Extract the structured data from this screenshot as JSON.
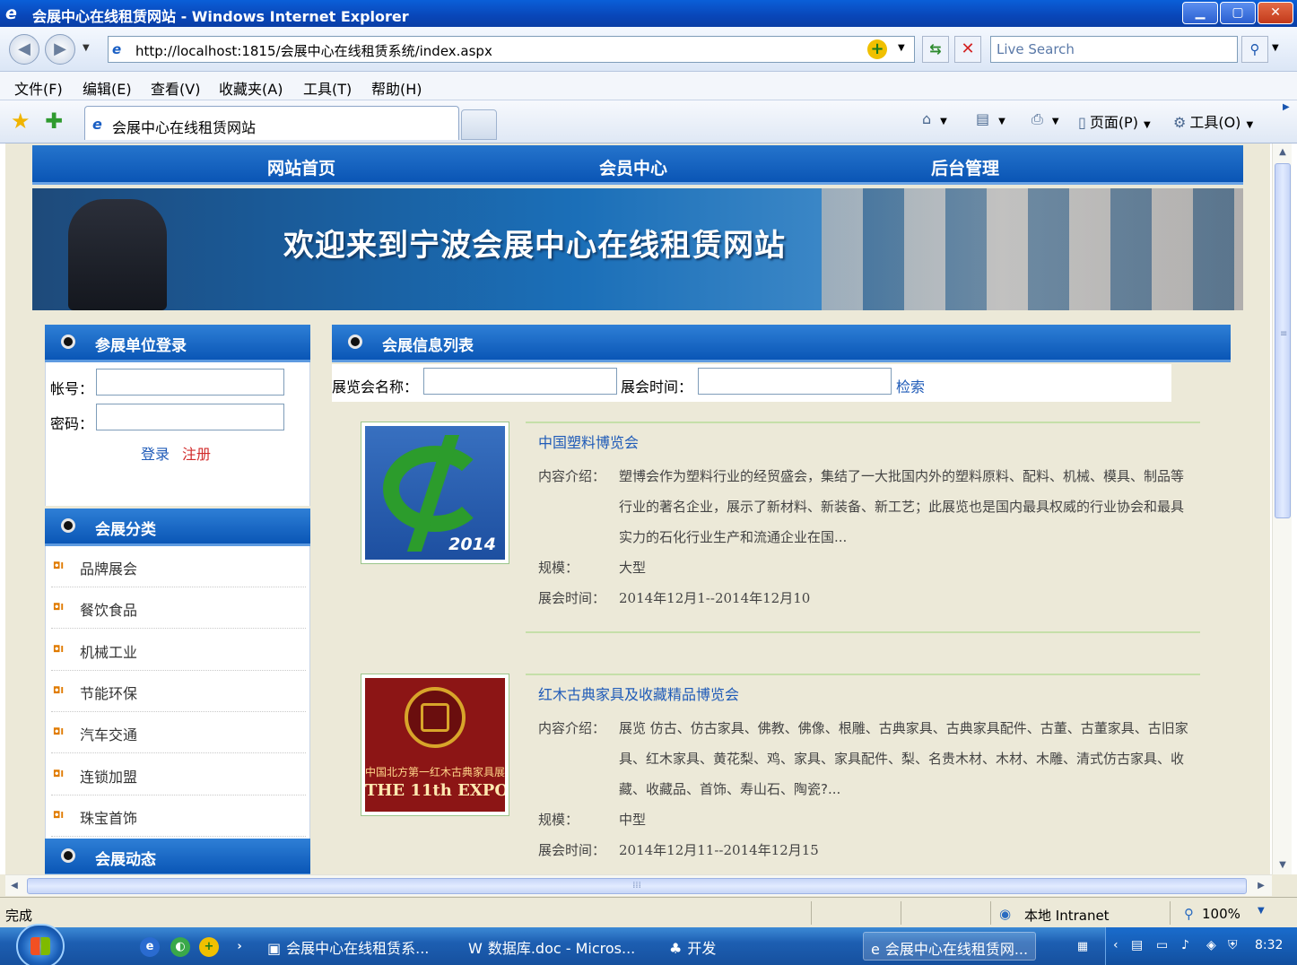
{
  "window": {
    "title": "会展中心在线租赁网站 - Windows Internet Explorer",
    "ie_glyph": "e",
    "buttons": {
      "minimize": "▁",
      "maximize": "▢",
      "close": "✕"
    }
  },
  "address": {
    "url": "http://localhost:1815/会展中心在线租赁系统/index.aspx",
    "search_placeholder": "Live Search"
  },
  "menu": [
    "文件(F)",
    "编辑(E)",
    "查看(V)",
    "收藏夹(A)",
    "工具(T)",
    "帮助(H)"
  ],
  "tab": {
    "title": "会展中心在线租赁网站"
  },
  "commands": {
    "page": "页面(P)",
    "tools": "工具(O)"
  },
  "site": {
    "nav": [
      "网站首页",
      "会员中心",
      "后台管理"
    ],
    "banner_text": "欢迎来到宁波会展中心在线租赁网站"
  },
  "login": {
    "heading": "参展单位登录",
    "account_label": "帐号：",
    "password_label": "密码：",
    "login_link": "登录",
    "register_link": "注册"
  },
  "categories": {
    "heading": "会展分类",
    "bullet": "◘Ι",
    "items": [
      "品牌展会",
      "餐饮食品",
      "机械工业",
      "节能环保",
      "汽车交通",
      "连锁加盟",
      "珠宝首饰"
    ]
  },
  "news": {
    "heading": "会展动态"
  },
  "expo_list": {
    "heading": "会展信息列表",
    "search": {
      "name_label": "展览会名称：",
      "time_label": "展会时间：",
      "button": "检索"
    },
    "labels": {
      "intro": "内容介绍：",
      "scale": "规模：",
      "time": "展会时间："
    },
    "items": [
      {
        "name": "中国塑料博览会",
        "intro": "塑博会作为塑料行业的经贸盛会，集结了一大批国内外的塑料原料、配料、机械、模具、制品等行业的著名企业，展示了新材料、新装备、新工艺；此展览也是国内最具权威的行业协会和最具实力的石化行业生产和流通企业在国...",
        "scale": "大型",
        "time": "2014年12月1--2014年12月10",
        "image_text": "2014"
      },
      {
        "name": "红木古典家具及收藏精品博览会",
        "intro": "展览 仿古、仿古家具、佛教、佛像、根雕、古典家具、古典家具配件、古董、古董家具、古旧家具、红木家具、黄花梨、鸡、家具、家具配件、梨、名贵木材、木材、木雕、清式仿古家具、收藏、收藏品、首饰、寿山石、陶瓷?...",
        "scale": "中型",
        "time": "2014年12月11--2014年12月15",
        "image_caption": "中国北方第一红木古典家具展",
        "image_title": "THE 11th EXPO"
      }
    ]
  },
  "status": {
    "left": "完成",
    "zone": "本地 Intranet",
    "zoom": "100%"
  },
  "taskbar": {
    "buttons": [
      "会展中心在线租赁系...",
      "数据库.doc - Micros...",
      "开发",
      "会展中心在线租赁网..."
    ],
    "clock": "8:32"
  }
}
